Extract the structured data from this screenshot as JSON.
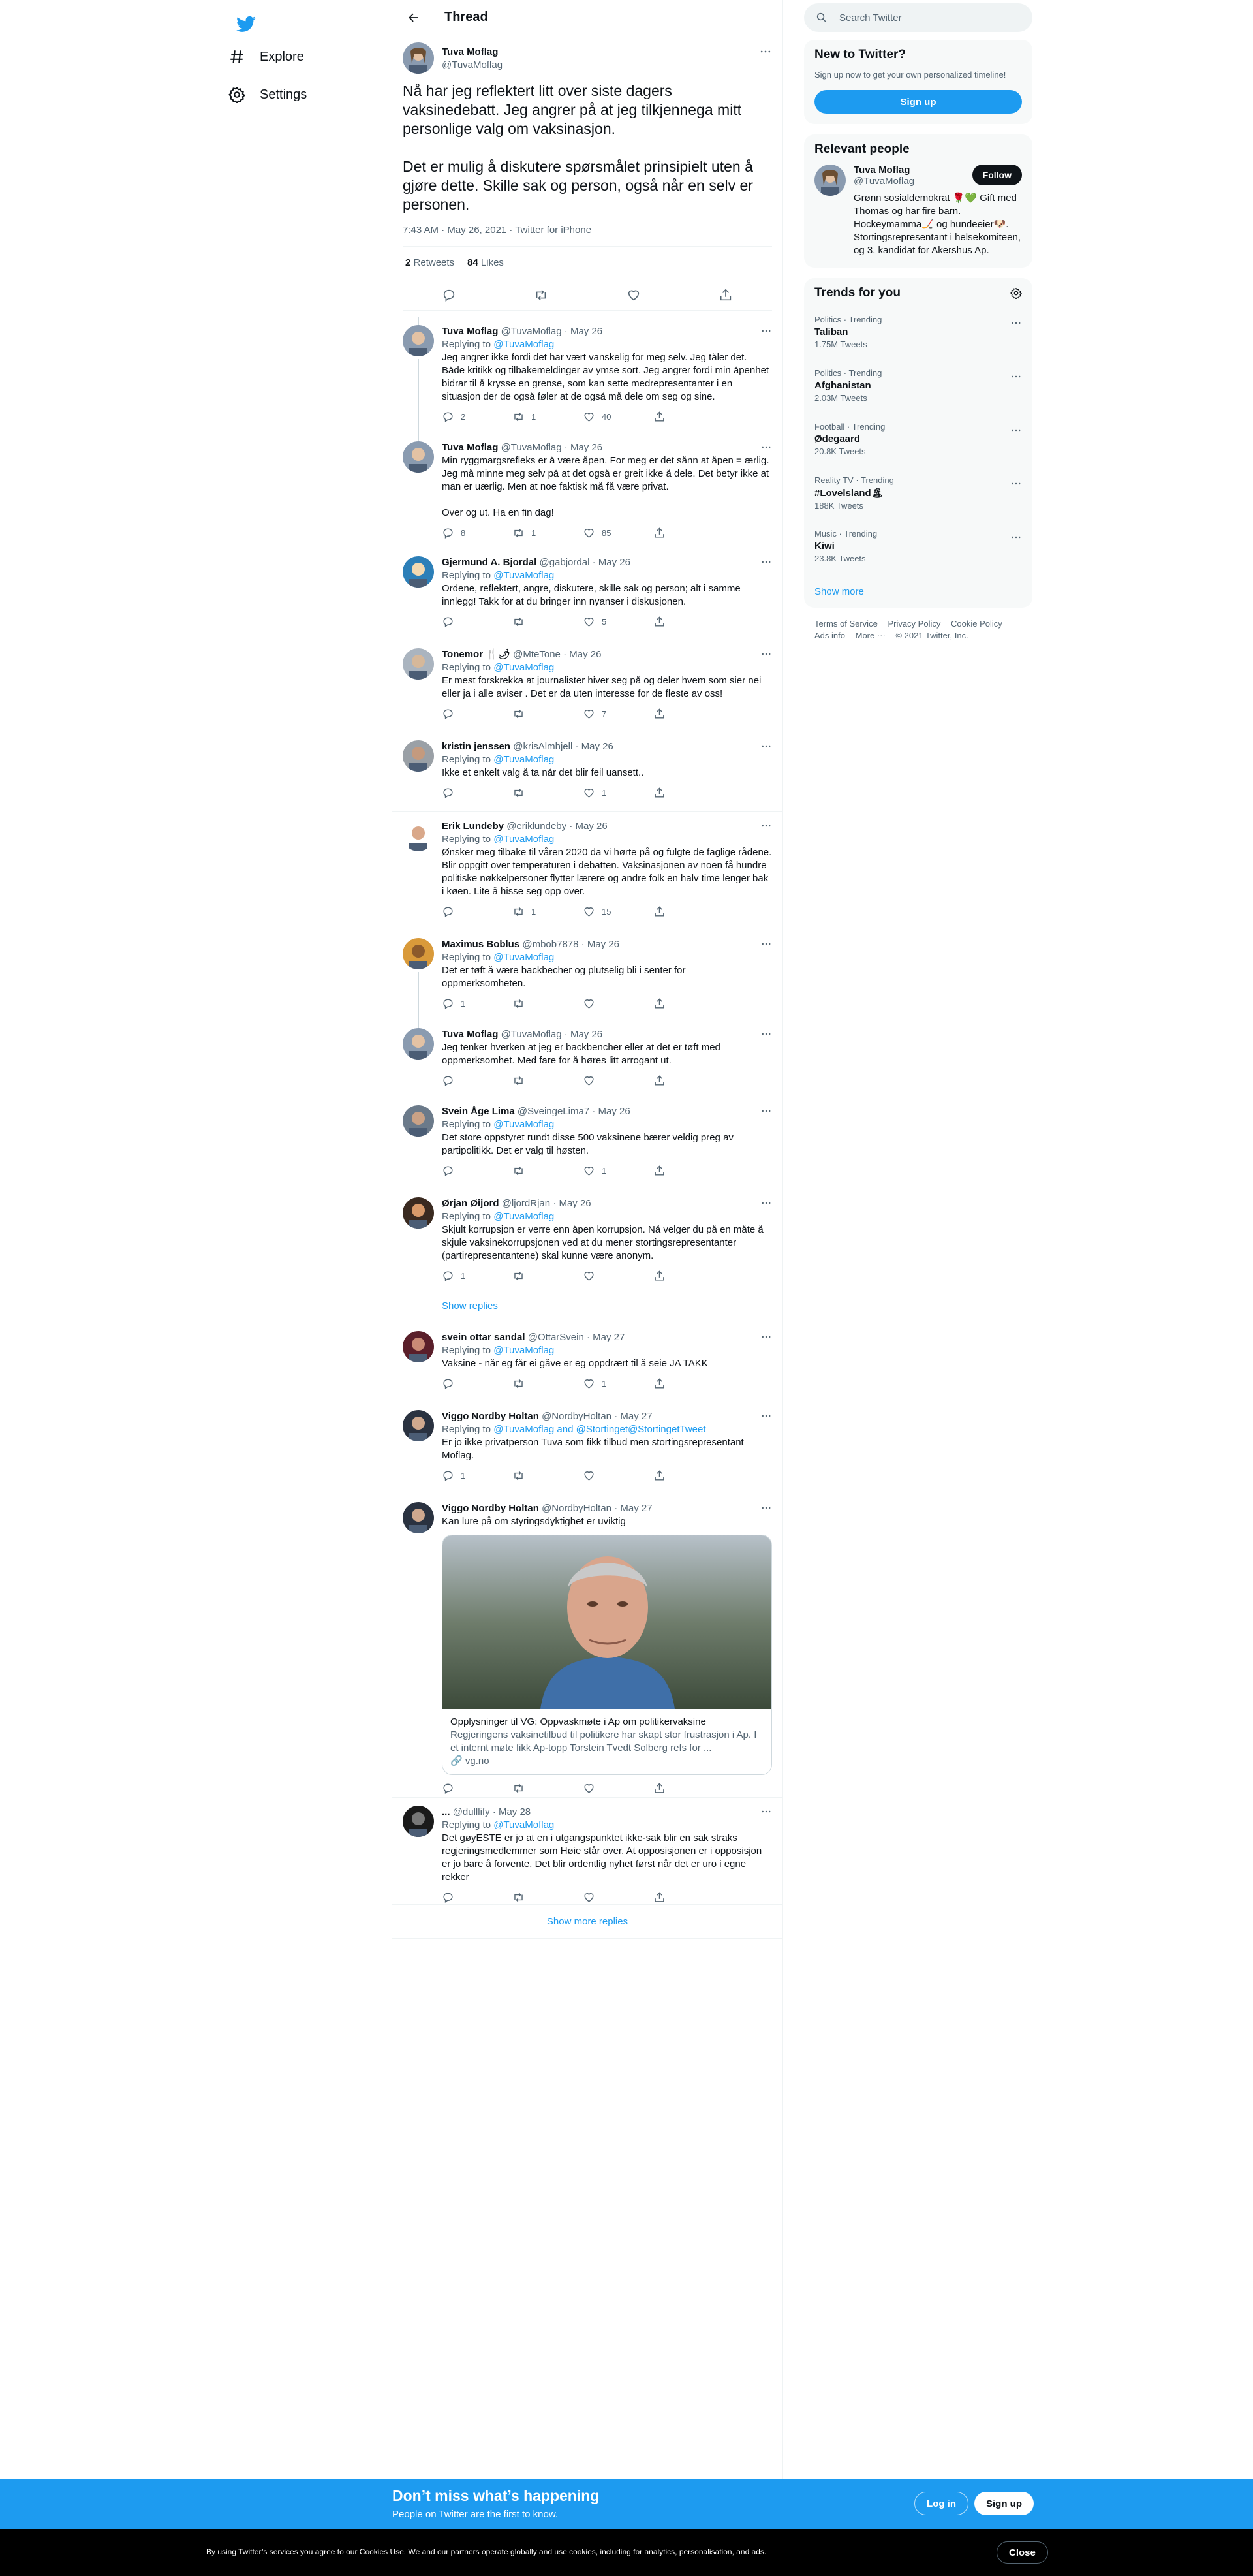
{
  "nav": {
    "explore": "Explore",
    "settings": "Settings"
  },
  "header": {
    "title": "Thread"
  },
  "focus": {
    "name": "Tuva Moflag",
    "handle": "@TuvaMoflag",
    "text": "Nå har jeg reflektert litt over siste dagers vaksinedebatt. Jeg angrer på at jeg tilkjennega mitt personlige valg om vaksinasjon.\n\nDet er mulig å diskutere spørsmålet prinsipielt uten å gjøre dette. Skille sak og person, også når en selv er personen.",
    "meta": "7:43 AM · May 26, 2021 · Twitter for iPhone",
    "retweets": "2",
    "retweets_label": "Retweets",
    "likes": "84",
    "likes_label": "Likes"
  },
  "tweets": [
    {
      "name": "Tuva Moflag",
      "handle": "@TuvaMoflag",
      "date": "· May 26",
      "reply_prefix": "Replying to",
      "reply_to": "@TuvaMoflag",
      "text": "Jeg angrer ikke fordi det har vært vanskelig for meg selv. Jeg tåler det. Både kritikk og tilbakemeldinger av ymse sort. Jeg angrer fordi min åpenhet bidrar til å krysse en grense, som kan sette medrepresentanter i en situasjon der de også føler at de også må dele om seg og sine.",
      "replies": "2",
      "rts": "1",
      "likes": "40"
    },
    {
      "name": "Tuva Moflag",
      "handle": "@TuvaMoflag",
      "date": "· May 26",
      "reply_prefix": "",
      "reply_to": "",
      "text": "Min ryggmargsrefleks er å være åpen. For meg er det sånn at åpen = ærlig. Jeg må minne meg selv på at det også er greit ikke å dele. Det betyr ikke at man er uærlig. Men at noe faktisk må få være privat.\n\nOver og ut. Ha en fin dag!",
      "replies": "8",
      "rts": "1",
      "likes": "85"
    },
    {
      "name": "Gjermund A. Bjordal",
      "handle": "@gabjordal",
      "date": "· May 26",
      "reply_prefix": "Replying to",
      "reply_to": "@TuvaMoflag",
      "text": "Ordene, reflektert, angre, diskutere, skille sak og person; alt i samme innlegg!  Takk for at du bringer inn nyanser i diskusjonen.",
      "replies": "",
      "rts": "",
      "likes": "5"
    },
    {
      "name": "Tonemor 🍴🌶",
      "handle": "@MteTone",
      "date": "· May 26",
      "reply_prefix": "Replying to",
      "reply_to": "@TuvaMoflag",
      "text": "Er mest forskrekka at journalister hiver seg på og deler hvem som sier nei eller ja i alle aviser . Det er da uten interesse for de fleste av oss!",
      "replies": "",
      "rts": "",
      "likes": "7"
    },
    {
      "name": "kristin jenssen",
      "handle": "@krisAlmhjell",
      "date": "· May 26",
      "reply_prefix": "Replying to",
      "reply_to": "@TuvaMoflag",
      "text": "Ikke et enkelt valg å ta når det blir feil uansett..",
      "replies": "",
      "rts": "",
      "likes": "1"
    },
    {
      "name": "Erik Lundeby",
      "handle": "@eriklundeby",
      "date": "· May 26",
      "reply_prefix": "Replying to",
      "reply_to": "@TuvaMoflag",
      "text": "Ønsker meg tilbake til våren 2020 da vi hørte på og fulgte de faglige rådene. Blir oppgitt over temperaturen i debatten. Vaksinasjonen av noen få hundre politiske nøkkelpersoner flytter lærere og andre folk en halv time lenger bak i køen. Lite å hisse seg opp over.",
      "replies": "",
      "rts": "1",
      "likes": "15"
    },
    {
      "name": "Maximus Boblus",
      "handle": "@mbob7878",
      "date": "· May 26",
      "reply_prefix": "Replying to",
      "reply_to": "@TuvaMoflag",
      "text": "Det er tøft å være backbecher og plutselig bli i senter for oppmerksomheten.",
      "replies": "1",
      "rts": "",
      "likes": ""
    },
    {
      "name": "Tuva Moflag",
      "handle": "@TuvaMoflag",
      "date": "· May 26",
      "reply_prefix": "",
      "reply_to": "",
      "text": "Jeg tenker hverken at jeg er backbencher eller at det er tøft med oppmerksomhet. Med fare for å høres litt arrogant ut.",
      "replies": "",
      "rts": "",
      "likes": ""
    },
    {
      "name": "Svein Åge Lima",
      "handle": "@SveingeLima7",
      "date": "· May 26",
      "reply_prefix": "Replying to",
      "reply_to": "@TuvaMoflag",
      "text": "Det store oppstyret rundt disse 500 vaksinene bærer veldig preg av partipolitikk. Det er valg til høsten.",
      "replies": "",
      "rts": "",
      "likes": "1"
    },
    {
      "name": "Ørjan Øijord",
      "handle": "@ljordRjan",
      "date": "· May 26",
      "reply_prefix": "Replying to",
      "reply_to": "@TuvaMoflag",
      "text": "Skjult korrupsjon er verre enn åpen korrupsjon. Nå velger du på en måte å skjule vaksinekorrupsjonen ved at du mener stortingsrepresentanter (partirepresentantene) skal kunne være anonym.",
      "replies": "1",
      "rts": "",
      "likes": ""
    },
    {
      "name": "svein ottar sandal",
      "handle": "@OttarSvein",
      "date": "· May 27",
      "reply_prefix": "Replying to",
      "reply_to": "@TuvaMoflag",
      "text": "Vaksine - når eg får ei gåve er eg oppdrært til å seie JA TAKK",
      "replies": "",
      "rts": "",
      "likes": "1"
    },
    {
      "name": "Viggo Nordby Holtan",
      "handle": "@NordbyHoltan",
      "date": "· May 27",
      "reply_prefix": "Replying to",
      "reply_to": "@TuvaMoflag and @Stortinget",
      "reply_to_b": "@StortingetTweet",
      "text": "Er jo ikke privatperson Tuva som fikk tilbud men stortingsrepresentant Moflag.",
      "replies": "1",
      "rts": "",
      "likes": ""
    },
    {
      "name": "Viggo Nordby Holtan",
      "handle": "@NordbyHoltan",
      "date": "· May 27",
      "reply_prefix": "",
      "reply_to": "",
      "text": "Kan lure på om styringsdyktighet er uviktig",
      "replies": "",
      "rts": "",
      "likes": ""
    },
    {
      "name": "...",
      "handle": "@dulllify",
      "date": "· May 28",
      "reply_prefix": "Replying to",
      "reply_to": "@TuvaMoflag",
      "text": "Det gøyESTE er jo at en i utgangspunktet ikke-sak blir en sak straks regjeringsmedlemmer som Høie står over. At opposisjonen er i opposisjon er jo bare å forvente. Det blir ordentlig nyhet først når det er uro i egne rekker",
      "replies": "",
      "rts": "",
      "likes": ""
    }
  ],
  "show_replies": "Show replies",
  "card": {
    "title": "Opplysninger til VG: Oppvaskmøte i Ap om politikervaksine",
    "desc": "Regjeringens vaksinetilbud til politikere har skapt stor frustrasjon i Ap. I et internt møte fikk Ap-topp Torstein Tvedt Solberg refs for ...",
    "domain": "vg.no"
  },
  "show_more_replies": "Show more replies",
  "right": {
    "search_placeholder": "Search Twitter",
    "new_title": "New to Twitter?",
    "new_sub": "Sign up now to get your own personalized timeline!",
    "signup": "Sign up",
    "relevant_title": "Relevant people",
    "rp_name": "Tuva Moflag",
    "rp_handle": "@TuvaMoflag",
    "follow": "Follow",
    "rp_bio": "Grønn sosialdemokrat 🌹💚 Gift med Thomas og har fire barn. Hockeymamma🏒 og hundeeier🐶. Stortingsrepresentant i helsekomiteen, og 3. kandidat for Akershus Ap.",
    "trends_title": "Trends for you",
    "trends": [
      {
        "meta": "Politics · Trending",
        "name": "Taliban",
        "count": "1.75M Tweets"
      },
      {
        "meta": "Politics · Trending",
        "name": "Afghanistan",
        "count": "2.03M Tweets"
      },
      {
        "meta": "Football · Trending",
        "name": "Ødegaard",
        "count": "20.8K Tweets"
      },
      {
        "meta": "Reality TV · Trending",
        "name": "#Lovelsland🏝",
        "count": "188K Tweets"
      },
      {
        "meta": "Music · Trending",
        "name": "Kiwi",
        "count": "23.8K Tweets"
      }
    ],
    "show_more": "Show more",
    "footer": [
      "Terms of Service",
      "Privacy Policy",
      "Cookie Policy",
      "Ads info",
      "More ···",
      "© 2021 Twitter, Inc."
    ]
  },
  "bottom": {
    "title": "Don’t miss what’s happening",
    "sub": "People on Twitter are the first to know.",
    "login": "Log in",
    "signup": "Sign up"
  },
  "cookie": {
    "text": "By using Twitter’s services you agree to our Cookies Use. We and our partners operate globally and use cookies, including for analytics, personalisation, and ads.",
    "close": "Close"
  },
  "colors": {
    "accent": "#1d9bf0",
    "text": "#0f1419",
    "secondary": "#536471"
  }
}
